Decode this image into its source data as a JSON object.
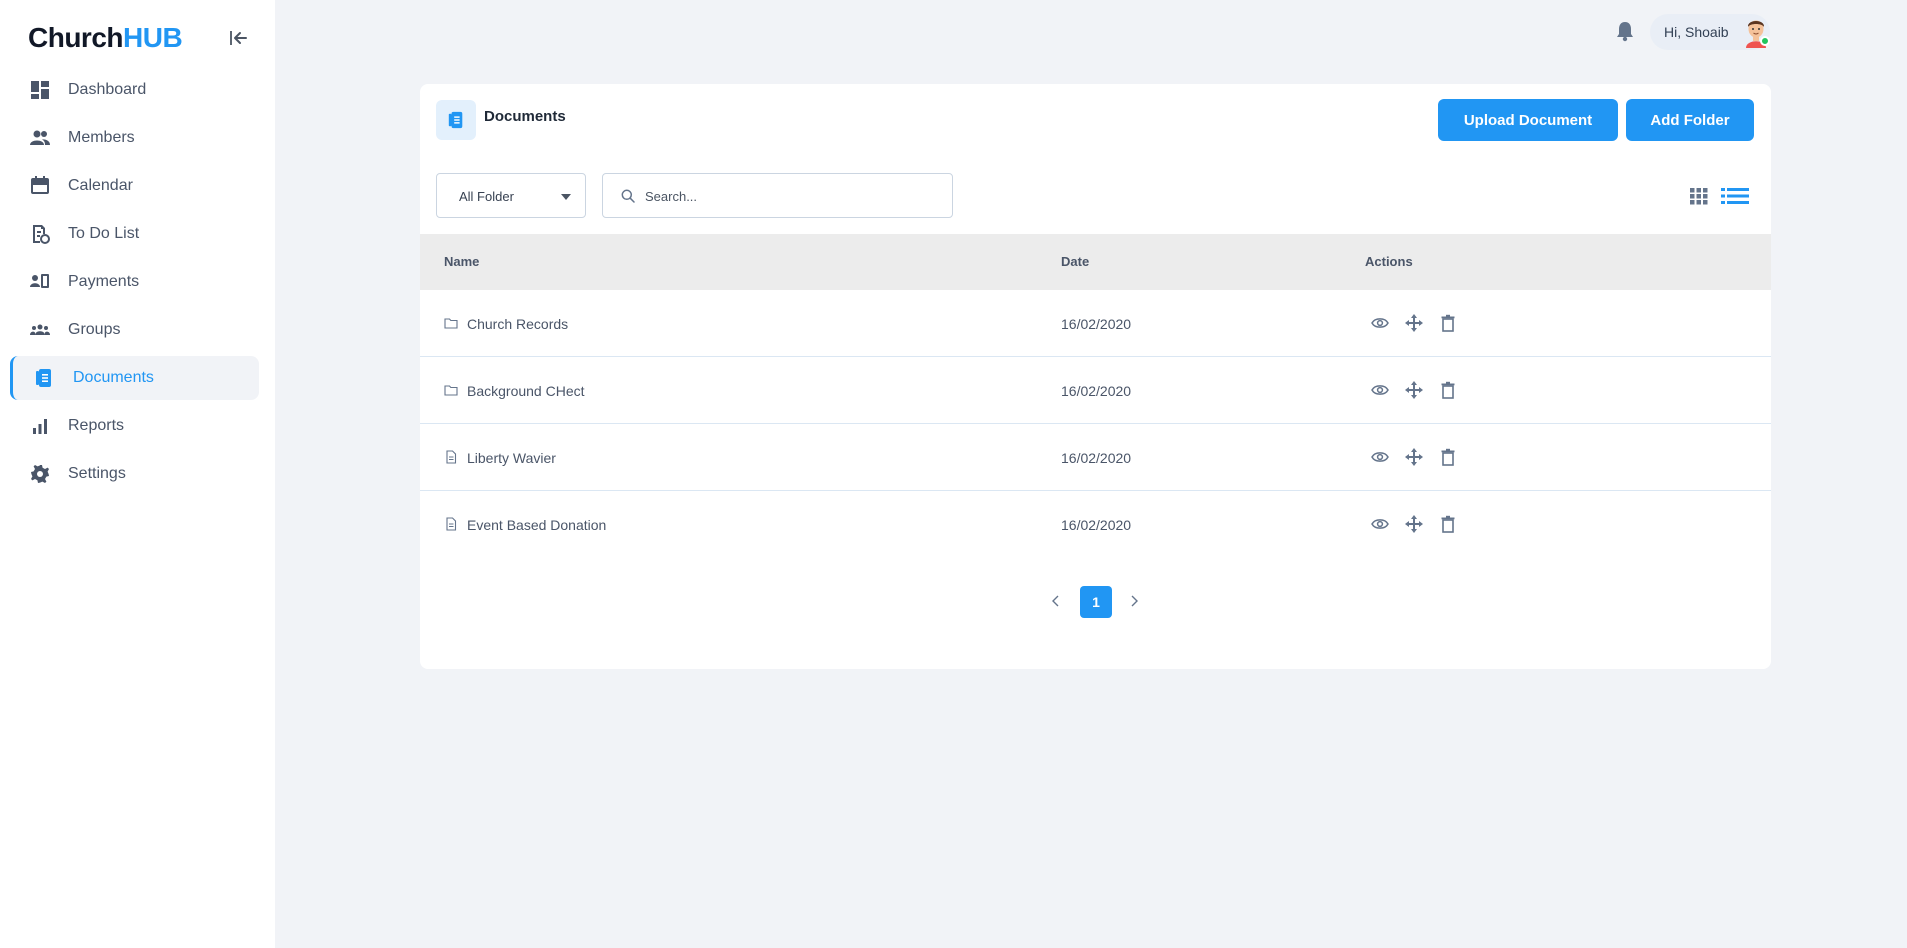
{
  "app": {
    "logo_part1": "Church",
    "logo_part2": "HUB",
    "brand_color": "#2196f3"
  },
  "sidebar": {
    "items": [
      {
        "label": "Dashboard",
        "icon": "dashboard-icon"
      },
      {
        "label": "Members",
        "icon": "members-icon"
      },
      {
        "label": "Calendar",
        "icon": "calendar-icon"
      },
      {
        "label": "To Do List",
        "icon": "todo-icon"
      },
      {
        "label": "Payments",
        "icon": "payments-icon"
      },
      {
        "label": "Groups",
        "icon": "groups-icon"
      },
      {
        "label": "Documents",
        "icon": "documents-icon",
        "active": true
      },
      {
        "label": "Reports",
        "icon": "reports-icon"
      },
      {
        "label": "Settings",
        "icon": "settings-icon"
      }
    ]
  },
  "header": {
    "greeting": "Hi, Shoaib",
    "status": "online"
  },
  "documents": {
    "title": "Documents",
    "upload_label": "Upload Document",
    "add_folder_label": "Add Folder",
    "folder_filter": "All Folder",
    "search_placeholder": "Search...",
    "view_mode": "list",
    "columns": {
      "name": "Name",
      "date": "Date",
      "actions": "Actions"
    },
    "rows": [
      {
        "name": "Church Records",
        "date": "16/02/2020",
        "type": "folder"
      },
      {
        "name": "Background CHect",
        "date": "16/02/2020",
        "type": "folder"
      },
      {
        "name": "Liberty Wavier",
        "date": "16/02/2020",
        "type": "file"
      },
      {
        "name": "Event Based Donation",
        "date": "16/02/2020",
        "type": "file"
      }
    ],
    "pagination": {
      "current_page": "1"
    }
  }
}
